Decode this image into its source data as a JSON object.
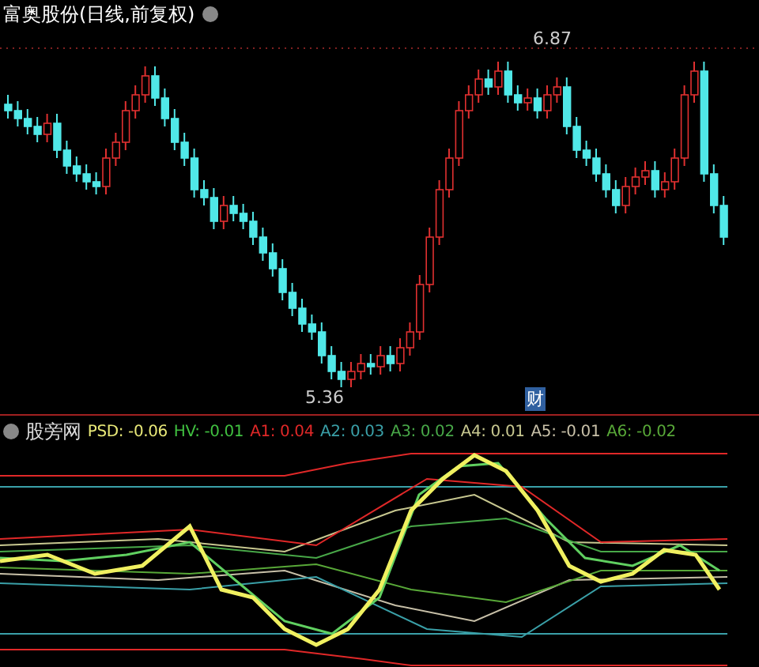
{
  "chart_title": "富奥股份(日线,前复权)",
  "price_marks": [
    {
      "kind": "high",
      "label": "6.87"
    },
    {
      "kind": "low",
      "label": "5.36"
    }
  ],
  "event_marker": "财",
  "indicator": {
    "name": "股旁网",
    "values": [
      {
        "name": "PSD:",
        "value": "-0.06",
        "color": "#e8e878"
      },
      {
        "name": "HV:",
        "value": "-0.01",
        "color": "#40c040"
      },
      {
        "name": "A1:",
        "value": "0.04",
        "color": "#e02828"
      },
      {
        "name": "A2:",
        "value": "0.03",
        "color": "#3aa0a8"
      },
      {
        "name": "A3:",
        "value": "0.02",
        "color": "#48a848"
      },
      {
        "name": "A4:",
        "value": "0.01",
        "color": "#c8c890"
      },
      {
        "name": "A5:",
        "value": "-0.01",
        "color": "#c8c0a8"
      },
      {
        "name": "A6:",
        "value": "-0.02",
        "color": "#58a838"
      }
    ]
  }
}
